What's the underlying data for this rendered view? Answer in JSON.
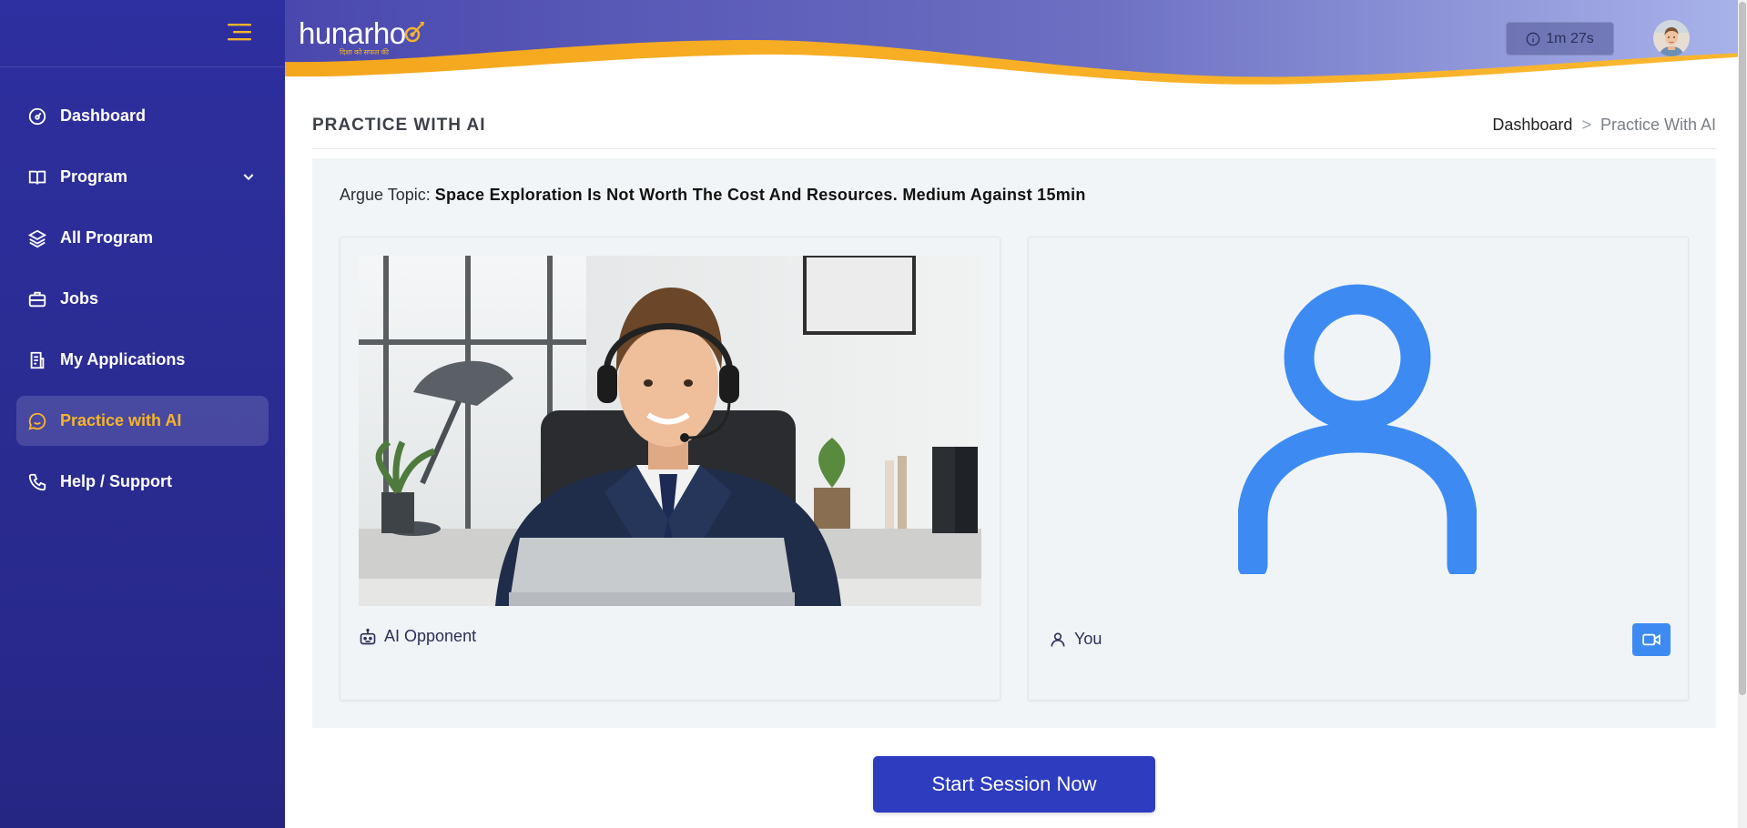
{
  "colors": {
    "sidebar_bg": "#2e2fa0",
    "accent": "#f6b42b",
    "primary_button": "#2e3cc0",
    "user_icon": "#3d8bf2"
  },
  "app": {
    "logo_text": "hunarho",
    "logo_tagline": "दिशा को सफल की"
  },
  "sidebar": {
    "menu_icon": "hamburger-icon",
    "items": [
      {
        "label": "Dashboard",
        "icon": "gauge-icon",
        "active": false
      },
      {
        "label": "Program",
        "icon": "book-icon",
        "active": false,
        "has_submenu": true
      },
      {
        "label": "All Program",
        "icon": "layers-icon",
        "active": false
      },
      {
        "label": "Jobs",
        "icon": "briefcase-icon",
        "active": false
      },
      {
        "label": "My Applications",
        "icon": "document-icon",
        "active": false
      },
      {
        "label": "Practice with AI",
        "icon": "chat-icon",
        "active": true
      },
      {
        "label": "Help / Support",
        "icon": "phone-icon",
        "active": false
      }
    ]
  },
  "header": {
    "timer": "1m 27s",
    "timer_icon": "info-icon",
    "avatar": "user-avatar"
  },
  "page": {
    "title": "PRACTICE WITH AI",
    "breadcrumb": {
      "home": "Dashboard",
      "separator": ">",
      "current": "Practice With AI"
    }
  },
  "practice": {
    "topic_prefix": "Argue Topic:",
    "topic": "Space Exploration Is Not Worth The Cost And Resources. Medium Against 15min",
    "ai_label": "AI Opponent",
    "user_label": "You"
  },
  "actions": {
    "start_label": "Start Session Now"
  }
}
